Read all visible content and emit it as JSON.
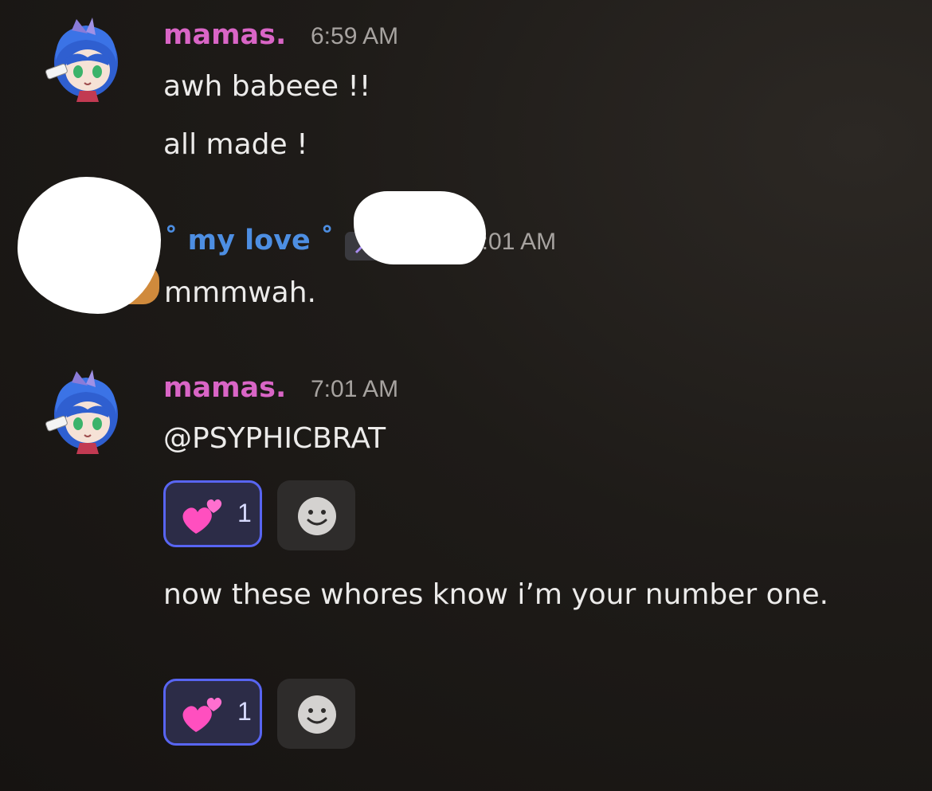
{
  "colors": {
    "mamas_name": "#d965c6",
    "love_name": "#4d8ee2",
    "reaction_border": "#5865f2"
  },
  "messages": [
    {
      "author": "mamas.",
      "time": "6:59 AM",
      "avatar": "blue-hair-anime-avatar",
      "lines": [
        "awh babeee !!",
        "all made !"
      ]
    },
    {
      "author": "˚ my love ˚",
      "time": "7:01 AM",
      "avatar": "hidden-avatar",
      "lines": [
        "mmmwah."
      ]
    },
    {
      "author": "mamas.",
      "time": "7:01 AM",
      "avatar": "blue-hair-anime-avatar",
      "lines": [
        "@PSYPHICBRAT",
        "now these whores know i’m your number one."
      ],
      "reactions": [
        {
          "emoji": "💕",
          "count": "1"
        },
        {
          "emoji": "💕",
          "count": "1"
        }
      ]
    }
  ]
}
